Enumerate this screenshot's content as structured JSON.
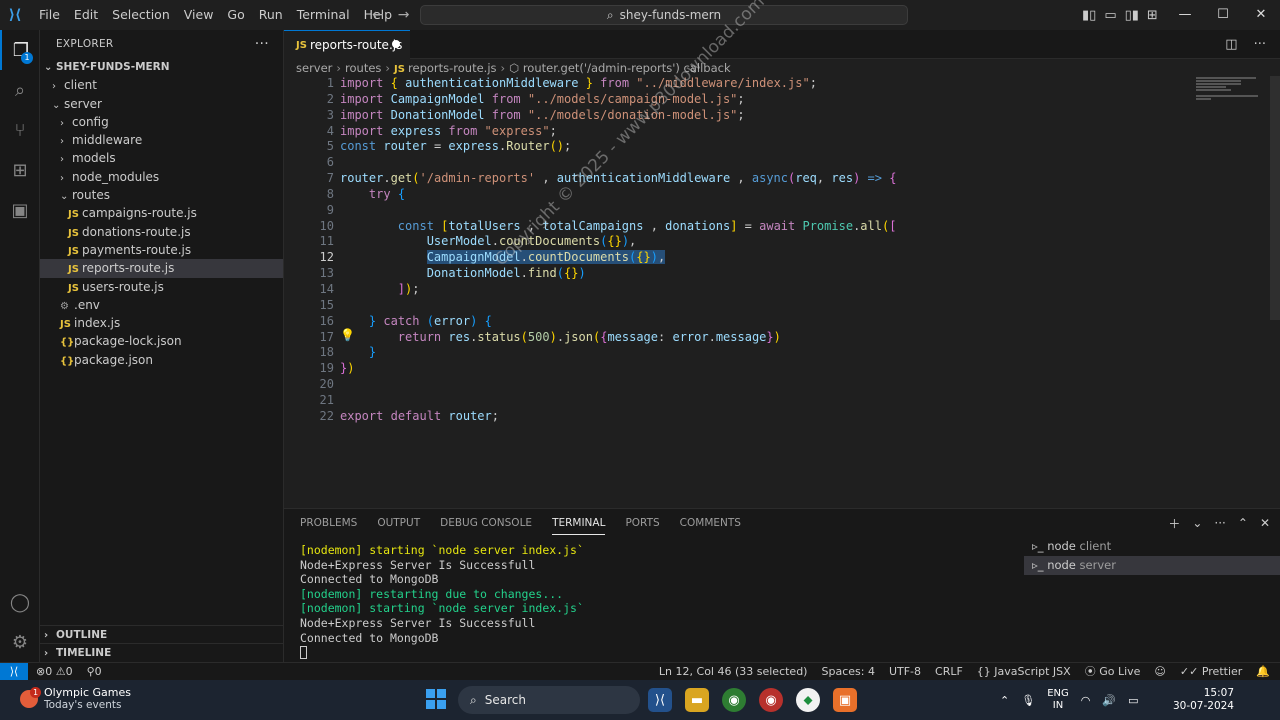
{
  "titlebar": {
    "menu": [
      "File",
      "Edit",
      "Selection",
      "View",
      "Go",
      "Run",
      "Terminal",
      "Help"
    ],
    "search_text": "shey-funds-mern"
  },
  "explorer": {
    "header": "EXPLORER",
    "root": "SHEY-FUNDS-MERN",
    "items": [
      {
        "label": "client",
        "type": "folder",
        "open": false,
        "depth": 1
      },
      {
        "label": "server",
        "type": "folder",
        "open": true,
        "depth": 1
      },
      {
        "label": "config",
        "type": "folder",
        "open": false,
        "depth": 2
      },
      {
        "label": "middleware",
        "type": "folder",
        "open": false,
        "depth": 2
      },
      {
        "label": "models",
        "type": "folder",
        "open": false,
        "depth": 2
      },
      {
        "label": "node_modules",
        "type": "folder",
        "open": false,
        "depth": 2
      },
      {
        "label": "routes",
        "type": "folder",
        "open": true,
        "depth": 2
      },
      {
        "label": "campaigns-route.js",
        "type": "js",
        "depth": 3
      },
      {
        "label": "donations-route.js",
        "type": "js",
        "depth": 3
      },
      {
        "label": "payments-route.js",
        "type": "js",
        "depth": 3
      },
      {
        "label": "reports-route.js",
        "type": "js",
        "depth": 3,
        "selected": true
      },
      {
        "label": "users-route.js",
        "type": "js",
        "depth": 3
      },
      {
        "label": ".env",
        "type": "env",
        "depth": 2
      },
      {
        "label": "index.js",
        "type": "js",
        "depth": 2
      },
      {
        "label": "package-lock.json",
        "type": "json",
        "depth": 2
      },
      {
        "label": "package.json",
        "type": "json",
        "depth": 2
      }
    ],
    "outline": "OUTLINE",
    "timeline": "TIMELINE"
  },
  "editor": {
    "tab": "reports-route.js",
    "breadcrumb": [
      "server",
      "routes",
      "reports-route.js",
      "router.get('/admin-reports') callback"
    ],
    "current_line": 12,
    "line_count": 22
  },
  "panel": {
    "tabs": [
      "PROBLEMS",
      "OUTPUT",
      "DEBUG CONSOLE",
      "TERMINAL",
      "PORTS",
      "COMMENTS"
    ],
    "active_tab": "TERMINAL",
    "terminal_lines": [
      "[nodemon] starting `node server index.js`",
      "Node+Express Server Is Successfull",
      "Connected to MongoDB",
      "[nodemon] restarting due to changes...",
      "[nodemon] starting `node server index.js`",
      "Node+Express Server Is Successfull",
      "Connected to MongoDB"
    ],
    "terminals": [
      {
        "name": "node",
        "sub": "client"
      },
      {
        "name": "node",
        "sub": "server"
      }
    ]
  },
  "status": {
    "errors": "0",
    "warnings": "0",
    "ports": "0",
    "position": "Ln 12, Col 46 (33 selected)",
    "spaces": "Spaces: 4",
    "encoding": "UTF-8",
    "eol": "CRLF",
    "language": "JavaScript JSX",
    "golive": "Go Live",
    "prettier": "Prettier"
  },
  "watermark": "Copyright © 2025 - www.p30download.com",
  "taskbar": {
    "weather_title": "Olympic Games",
    "weather_sub": "Today's events",
    "weather_badge": "1",
    "search": "Search",
    "lang1": "ENG",
    "lang2": "IN",
    "time": "15:07",
    "date": "30-07-2024"
  }
}
